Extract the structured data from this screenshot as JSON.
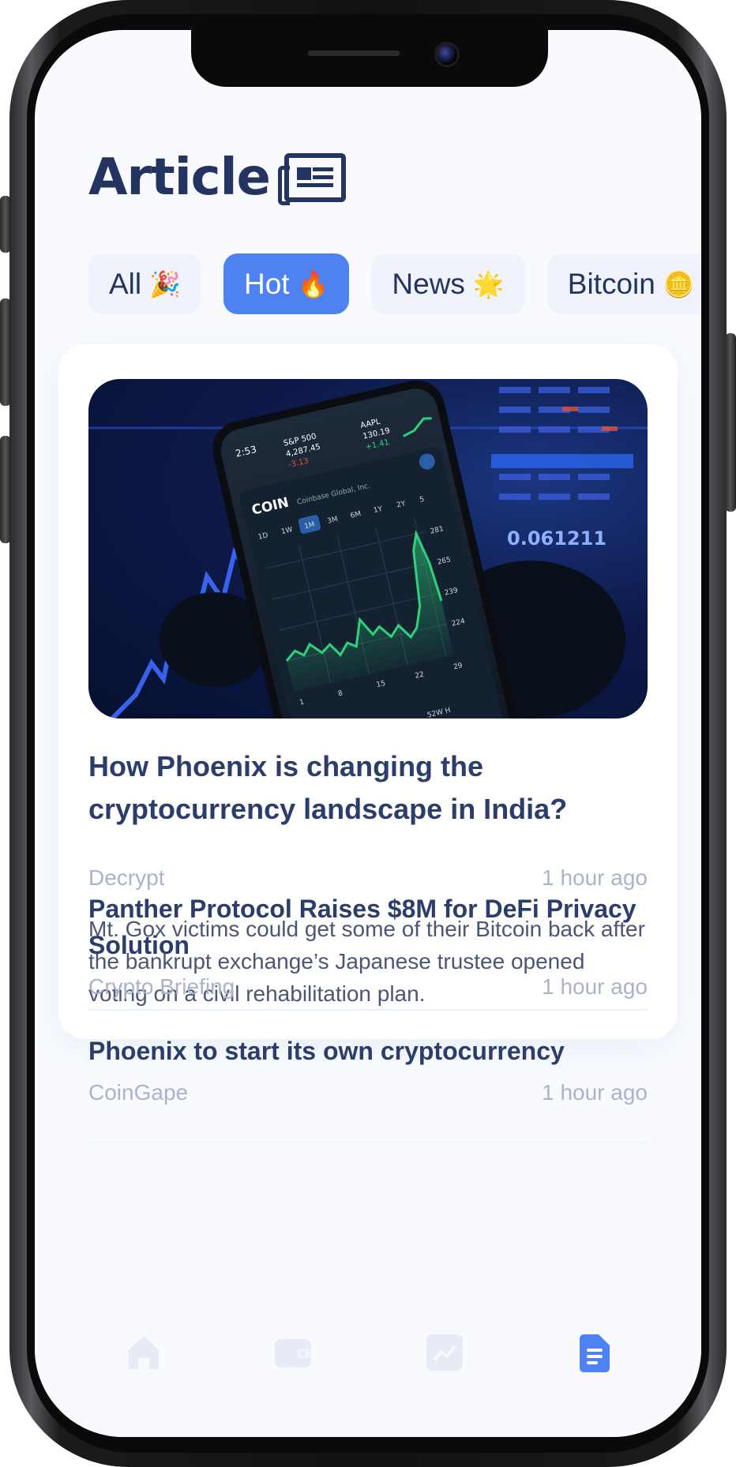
{
  "header": {
    "title": "Article"
  },
  "tabs": [
    {
      "label": "All",
      "emoji": "🎉",
      "active": false
    },
    {
      "label": "Hot",
      "emoji": "🔥",
      "active": true
    },
    {
      "label": "News",
      "emoji": "🌟",
      "active": false
    },
    {
      "label": "Bitcoin",
      "emoji": "🪙",
      "active": false
    }
  ],
  "featured": {
    "title": "How Phoenix is changing the cryptocurrency landscape in India?",
    "source": "Decrypt",
    "time": "1 hour ago",
    "description": "Mt. Gox victims could get some of their Bitcoin back after the bankrupt exchange’s Japanese trustee opened voting on a civil rehabilitation plan.",
    "image": {
      "brand": "COIN",
      "company": "Coinbase Global, Inc.",
      "ranges": [
        "1D",
        "1W",
        "1M",
        "3M",
        "6M",
        "1Y",
        "2Y",
        "5"
      ],
      "selected_range": "1M",
      "axis": [
        "281",
        "265",
        "239",
        "224"
      ],
      "xaxis": [
        "1",
        "8",
        "15",
        "22",
        "29"
      ],
      "tickers": [
        {
          "sym": "S&P 500",
          "val": "4,287.45",
          "chg": "-3.13"
        },
        {
          "sym": "AAPL",
          "val": "130.19",
          "chg": "+1.41"
        }
      ],
      "clock": "2:53",
      "screen_value": "0.061211"
    }
  },
  "articles": [
    {
      "title": "Panther Protocol Raises $8M for DeFi Privacy Solution",
      "source": "Crypto Briefing",
      "time": "1 hour ago"
    },
    {
      "title": "Phoenix to start its own cryptocurrency",
      "source": "CoinGape",
      "time": "1 hour ago"
    }
  ],
  "nav": {
    "items": [
      "home-icon",
      "wallet-icon",
      "chart-icon",
      "article-icon"
    ],
    "active": "article-icon",
    "active_color": "#4e82f0",
    "inactive_color": "#e6ebf6"
  }
}
